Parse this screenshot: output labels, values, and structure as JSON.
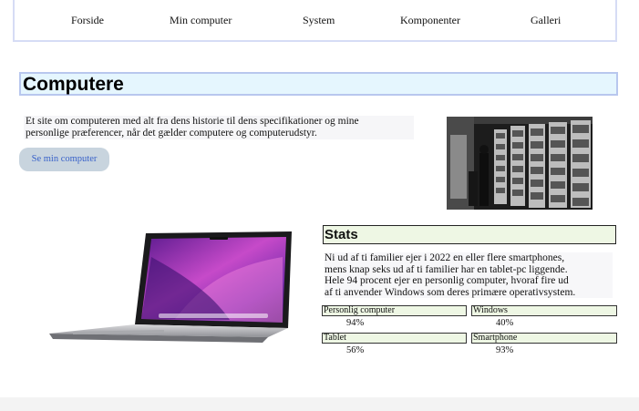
{
  "nav": {
    "items": [
      {
        "label": "Forside"
      },
      {
        "label": "Min computer"
      },
      {
        "label": "System"
      },
      {
        "label": "Komponenter"
      },
      {
        "label": "Galleri"
      }
    ]
  },
  "hero": {
    "title": "Computere",
    "intro_line1": "Et site om computeren med alt fra dens historie til dens specifikationer og mine",
    "intro_line2": "personlige præferencer, når det gælder computere og computerudstyr.",
    "cta_label": "Se min computer"
  },
  "stats": {
    "title": "Stats",
    "text_lines": [
      "Ni ud af ti familier ejer i 2022 en eller flere smartphones,",
      "mens knap seks ud af ti familier har en tablet-pc liggende.",
      "Hele 94 procent ejer en personlig computer, hvoraf fire ud",
      "af ti anvender Windows som deres primære operativsystem."
    ],
    "items": [
      {
        "label": "Personlig computer",
        "value": "94%"
      },
      {
        "label": "Windows",
        "value": "40%"
      },
      {
        "label": "Tablet",
        "value": "56%"
      },
      {
        "label": "Smartphone",
        "value": "93%"
      }
    ]
  },
  "colors": {
    "title_bg": "#e5f6fe",
    "title_border": "#b8c7ee",
    "stats_bg": "#eef7e4",
    "button_bg": "#c8d4de",
    "button_text": "#3a63c9"
  }
}
